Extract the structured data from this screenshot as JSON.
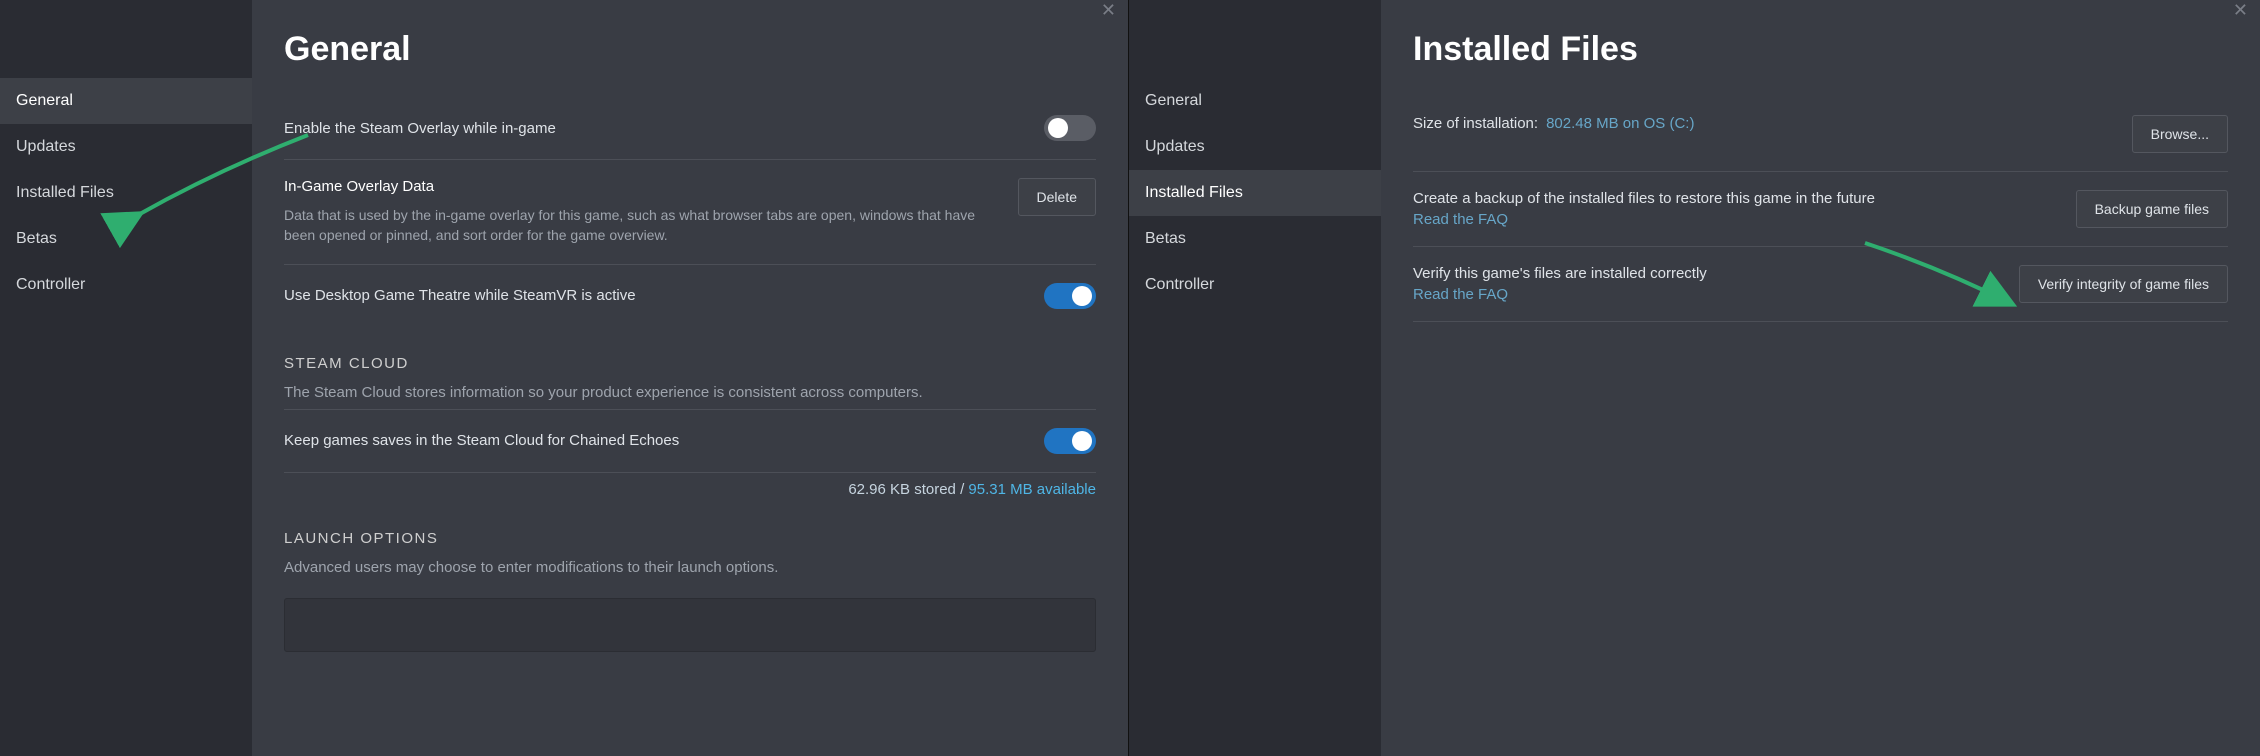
{
  "left": {
    "sidebar": {
      "items": [
        "General",
        "Updates",
        "Installed Files",
        "Betas",
        "Controller"
      ],
      "active_index": 0
    },
    "title": "General",
    "overlay_row_label": "Enable the Steam Overlay while in-game",
    "ingame_overlay": {
      "title": "In-Game Overlay Data",
      "desc": "Data that is used by the in-game overlay for this game, such as what browser tabs are open, windows that have been opened or pinned, and sort order for the game overview.",
      "delete_btn": "Delete"
    },
    "desktop_theatre_label": "Use Desktop Game Theatre while SteamVR is active",
    "cloud": {
      "head": "STEAM CLOUD",
      "sub": "The Steam Cloud stores information so your product experience is consistent across computers.",
      "keep_label": "Keep games saves in the Steam Cloud for Chained Echoes",
      "storage_prefix": "62.96 KB stored / ",
      "storage_avail": "95.31 MB available"
    },
    "launch": {
      "head": "LAUNCH OPTIONS",
      "sub": "Advanced users may choose to enter modifications to their launch options.",
      "value": ""
    }
  },
  "right": {
    "sidebar": {
      "items": [
        "General",
        "Updates",
        "Installed Files",
        "Betas",
        "Controller"
      ],
      "active_index": 2
    },
    "title": "Installed Files",
    "install": {
      "prefix": "Size of installation:",
      "path": "802.48 MB on OS (C:)",
      "browse_btn": "Browse..."
    },
    "backup": {
      "text": "Create a backup of the installed files to restore this game in the future",
      "faq": "Read the FAQ",
      "btn": "Backup game files"
    },
    "verify": {
      "text": "Verify this game's files are installed correctly",
      "faq": "Read the FAQ",
      "btn": "Verify integrity of game files"
    }
  }
}
